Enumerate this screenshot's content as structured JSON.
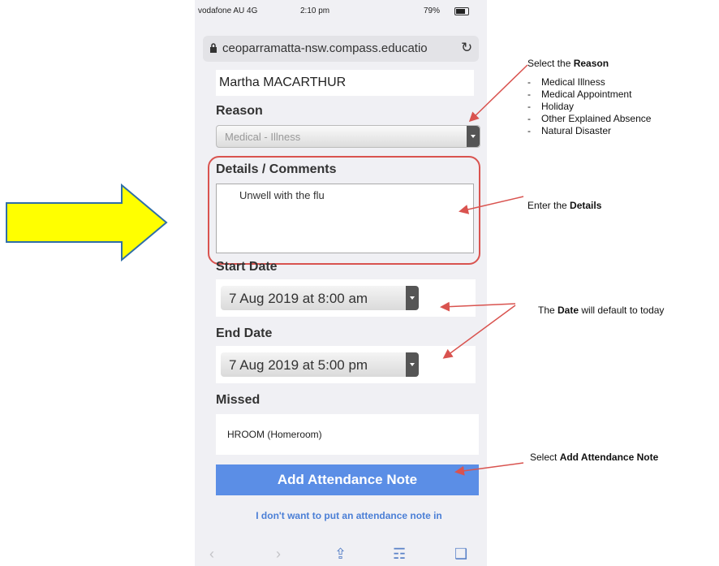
{
  "status_bar": {
    "carrier": "vodafone AU  4G",
    "time": "2:10 pm",
    "battery": "79%"
  },
  "browser": {
    "url": "ceoparramatta-nsw.compass.educatio"
  },
  "form": {
    "student_name": "Martha MACARTHUR",
    "reason_label": "Reason",
    "reason_value": "Medical - Illness",
    "details_label": "Details / Comments",
    "details_value": "Unwell with the flu",
    "start_label": "Start Date",
    "start_value": "7 Aug 2019 at 8:00 am",
    "end_label": "End Date",
    "end_value": "7 Aug 2019 at 5:00 pm",
    "missed_label": "Missed",
    "missed_value": "HROOM (Homeroom)",
    "submit_label": "Add Attendance Note",
    "skip_label": "I don't want to put an attendance note in"
  },
  "annotations": {
    "reason_pre": "Select the ",
    "reason_bold": "Reason",
    "reason_options": [
      "Medical Illness",
      "Medical Appointment",
      "Holiday",
      "Other Explained Absence",
      "Natural Disaster"
    ],
    "details_pre": "Enter the ",
    "details_bold": "Details",
    "date_pre": "The ",
    "date_bold": "Date",
    "date_post": " will default to today",
    "add_pre": "Select ",
    "add_bold": "Add Attendance Note"
  },
  "colors": {
    "arrow_fill": "#ffff00",
    "arrow_stroke": "#2f6fa8",
    "callout": "#d9534f",
    "button": "#5b8ee6"
  },
  "icons": [
    "lock-icon",
    "reload-icon",
    "chevron-left-icon",
    "chevron-right-icon",
    "share-icon",
    "bookmarks-icon",
    "tabs-icon"
  ]
}
